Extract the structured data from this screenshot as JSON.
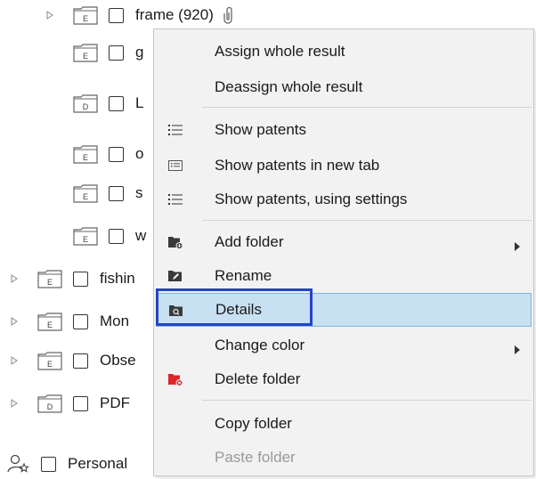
{
  "tree": {
    "rows": [
      {
        "label": "frame (920)",
        "folder_letter": "E",
        "expander": true
      },
      {
        "label": "g",
        "folder_letter": "E",
        "expander": false
      },
      {
        "label": "L",
        "folder_letter": "D",
        "expander": false
      },
      {
        "label": "o",
        "folder_letter": "E",
        "expander": false
      },
      {
        "label": "s",
        "folder_letter": "E",
        "expander": false
      },
      {
        "label": "w",
        "folder_letter": "E",
        "expander": false
      },
      {
        "label": "fishin",
        "folder_letter": "E",
        "expander": true
      },
      {
        "label": "Mon",
        "folder_letter": "E",
        "expander": true
      },
      {
        "label": "Obse",
        "folder_letter": "E",
        "expander": true
      },
      {
        "label": "PDF",
        "folder_letter": "D",
        "expander": true
      },
      {
        "label": "Personal",
        "folder_letter": "",
        "expander": false
      }
    ]
  },
  "context_menu": {
    "items": [
      {
        "label": "Assign whole result",
        "icon": "",
        "submenu": false
      },
      {
        "label": "Deassign whole result",
        "icon": "",
        "submenu": false
      },
      {
        "label": "Show patents",
        "icon": "list-icon",
        "submenu": false
      },
      {
        "label": "Show patents in new tab",
        "icon": "tab-list-icon",
        "submenu": false
      },
      {
        "label": "Show patents, using settings",
        "icon": "list-settings-icon",
        "submenu": false
      },
      {
        "label": "Add folder",
        "icon": "add-folder-icon",
        "submenu": true
      },
      {
        "label": "Rename",
        "icon": "rename-icon",
        "submenu": false
      },
      {
        "label": "Details",
        "icon": "details-icon",
        "submenu": false,
        "highlighted": true
      },
      {
        "label": "Change color",
        "icon": "",
        "submenu": true
      },
      {
        "label": "Delete folder",
        "icon": "delete-folder-icon",
        "submenu": false
      },
      {
        "label": "Copy folder",
        "icon": "",
        "submenu": false
      },
      {
        "label": "Paste folder",
        "icon": "",
        "submenu": false,
        "disabled": true
      }
    ]
  },
  "colors": {
    "menu_bg": "#f2f2f2",
    "highlight_bg": "#c7e0f2",
    "focus_ring": "#2445c6",
    "delete_icon": "#e0242a"
  }
}
